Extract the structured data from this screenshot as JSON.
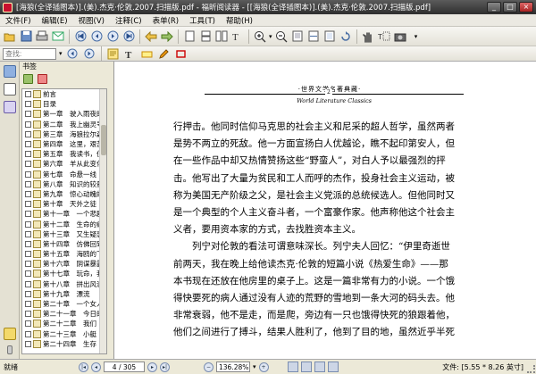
{
  "window": {
    "title": "[海狼(全译插图本)].(美).杰克·伦敦.2007.扫描版.pdf - 福昕阅读器 - [[海狼(全译插图本)].(美).杰克·伦敦.2007.扫描版.pdf]",
    "minimize": "_",
    "maximize": "□",
    "close": "×"
  },
  "menu": [
    "文件(F)",
    "编辑(E)",
    "视图(V)",
    "注释(C)",
    "表单(R)",
    "工具(T)",
    "帮助(H)"
  ],
  "toolbar": {
    "search_placeholder": "查找:",
    "zoom_icon": "magnifier-icon"
  },
  "sidebar": {
    "header": "书签",
    "bookmarks": [
      "前言",
      "目录",
      "第一章　驶入雨夜的帆",
      "第二章　我上幽灵号",
      "第三章　海狼拉尔森",
      "第四章　这里，艰苦求生",
      "第五章　我读书，但",
      "第六章　羊从此变化",
      "第七章　命悬一线",
      "第八章　知识的较量",
      "第九章　惊心动魄的",
      "第十章　天外之徒",
      "第十一章　一个悲剧的",
      "第十二章　生命的疯狂",
      "第十三章　又生疑惑",
      "第十四章　仿佛回到",
      "第十五章　海鸥的飞翔",
      "第十六章　阴谋暴露",
      "第十七章　玩命，我",
      "第十八章　拼出风浪",
      "第十九章　漂流",
      "第二十章　一个女人",
      "第二十一章　今日的",
      "第二十二章　我们",
      "第二十三章　小艇",
      "第二十四章　生存"
    ]
  },
  "document": {
    "running_head": "·世界文学名著典藏·",
    "page_number": "2",
    "series_english": "World Literature Classics",
    "lines": [
      "行押击。他同时信仰马克思的社会主义和尼采的超人哲学，虽然两者",
      "是势不两立的死敌。他一方面宣扬白人优越论，瞧不起印第安人，但",
      "在一些作品中却又热情赞扬这些“野蛮人”，对白人予以最强烈的抨",
      "击。他写出了大量为贫民和工人而呼的杰作，投身社会主义运动，被",
      "称为美国无产阶级之父，是社会主义党派的总统候选人。但他同时又",
      "是一个典型的个人主义奋斗者，一个富豪作家。他声称他这个社会主",
      "义者，要用资本家的方式，去找胜资本主义。",
      "　　列宁对伦敦的看法可谓意味深长。列宁夫人回忆：“伊里奇逝世",
      "前两天，我在晚上给他读杰克·伦敦的短篇小说《热爱生命》——那",
      "本书现在还放在他房里的桌子上。这是一篇非常有力的小说。一个饿",
      "得快要死的病人通过没有人迹的荒野的雪地到一条大河的码头去。他",
      "非常衰弱，他不是走，而是爬，旁边有一只也饿得快死的狼跟着他，",
      "他们之间进行了搏斗，结果人胜利了，他到了目的地，虽然近乎半死"
    ]
  },
  "status": {
    "ready": "就绪",
    "page": "4 / 305",
    "zoom": "136.28%",
    "file_size": "文件: [5.55 * 8.26 英寸]"
  }
}
